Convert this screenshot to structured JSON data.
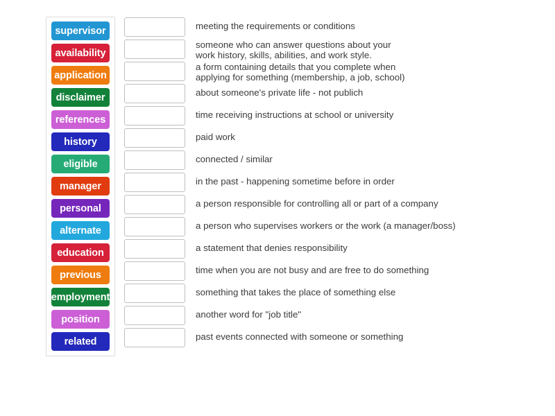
{
  "activity": {
    "type": "match-up",
    "background_color": "#ffffff",
    "tray_border_color": "#dcdcdc",
    "drop_box_border_color": "#bfbfbf",
    "definition_text_color": "#3b3b3b"
  },
  "tiles": [
    {
      "label": "supervisor",
      "color": "#2196d3"
    },
    {
      "label": "availability",
      "color": "#d62139"
    },
    {
      "label": "application",
      "color": "#ef7c0e"
    },
    {
      "label": "disclaimer",
      "color": "#12823a"
    },
    {
      "label": "references",
      "color": "#cc5fd6"
    },
    {
      "label": "history",
      "color": "#2329bb"
    },
    {
      "label": "eligible",
      "color": "#26ab77"
    },
    {
      "label": "manager",
      "color": "#e03c10"
    },
    {
      "label": "personal",
      "color": "#7526bb"
    },
    {
      "label": "alternate",
      "color": "#23a8dd"
    },
    {
      "label": "education",
      "color": "#d62139"
    },
    {
      "label": "previous",
      "color": "#ef7c0e"
    },
    {
      "label": "employment",
      "color": "#12823a"
    },
    {
      "label": "position",
      "color": "#cc5fd6"
    },
    {
      "label": "related",
      "color": "#2329bb"
    }
  ],
  "rows": [
    {
      "answer": "",
      "definition": "meeting the requirements or conditions",
      "lines": 1
    },
    {
      "answer": "",
      "definition": "someone who can answer questions about your\nwork history, skills, abilities, and work style.",
      "lines": 2
    },
    {
      "answer": "",
      "definition": "a form containing details that you complete when\napplying for something (membership, a job, school)",
      "lines": 2
    },
    {
      "answer": "",
      "definition": "about someone's private life - not publich",
      "lines": 1
    },
    {
      "answer": "",
      "definition": "time receiving instructions at school or university",
      "lines": 1
    },
    {
      "answer": "",
      "definition": "paid work",
      "lines": 1
    },
    {
      "answer": "",
      "definition": "connected / similar",
      "lines": 1
    },
    {
      "answer": "",
      "definition": "in the past - happening sometime before in order",
      "lines": 1
    },
    {
      "answer": "",
      "definition": "a person responsible for controlling all or part of a company",
      "lines": 1
    },
    {
      "answer": "",
      "definition": "a person who supervises workers or the work (a manager/boss)",
      "lines": 1
    },
    {
      "answer": "",
      "definition": "a statement that denies responsibility",
      "lines": 1
    },
    {
      "answer": "",
      "definition": "time when you are not busy and are free to do something",
      "lines": 1
    },
    {
      "answer": "",
      "definition": "something that takes the place of something else",
      "lines": 1
    },
    {
      "answer": "",
      "definition": "another word for \"job title\"",
      "lines": 1
    },
    {
      "answer": "",
      "definition": "past events connected with someone or something",
      "lines": 1
    }
  ]
}
